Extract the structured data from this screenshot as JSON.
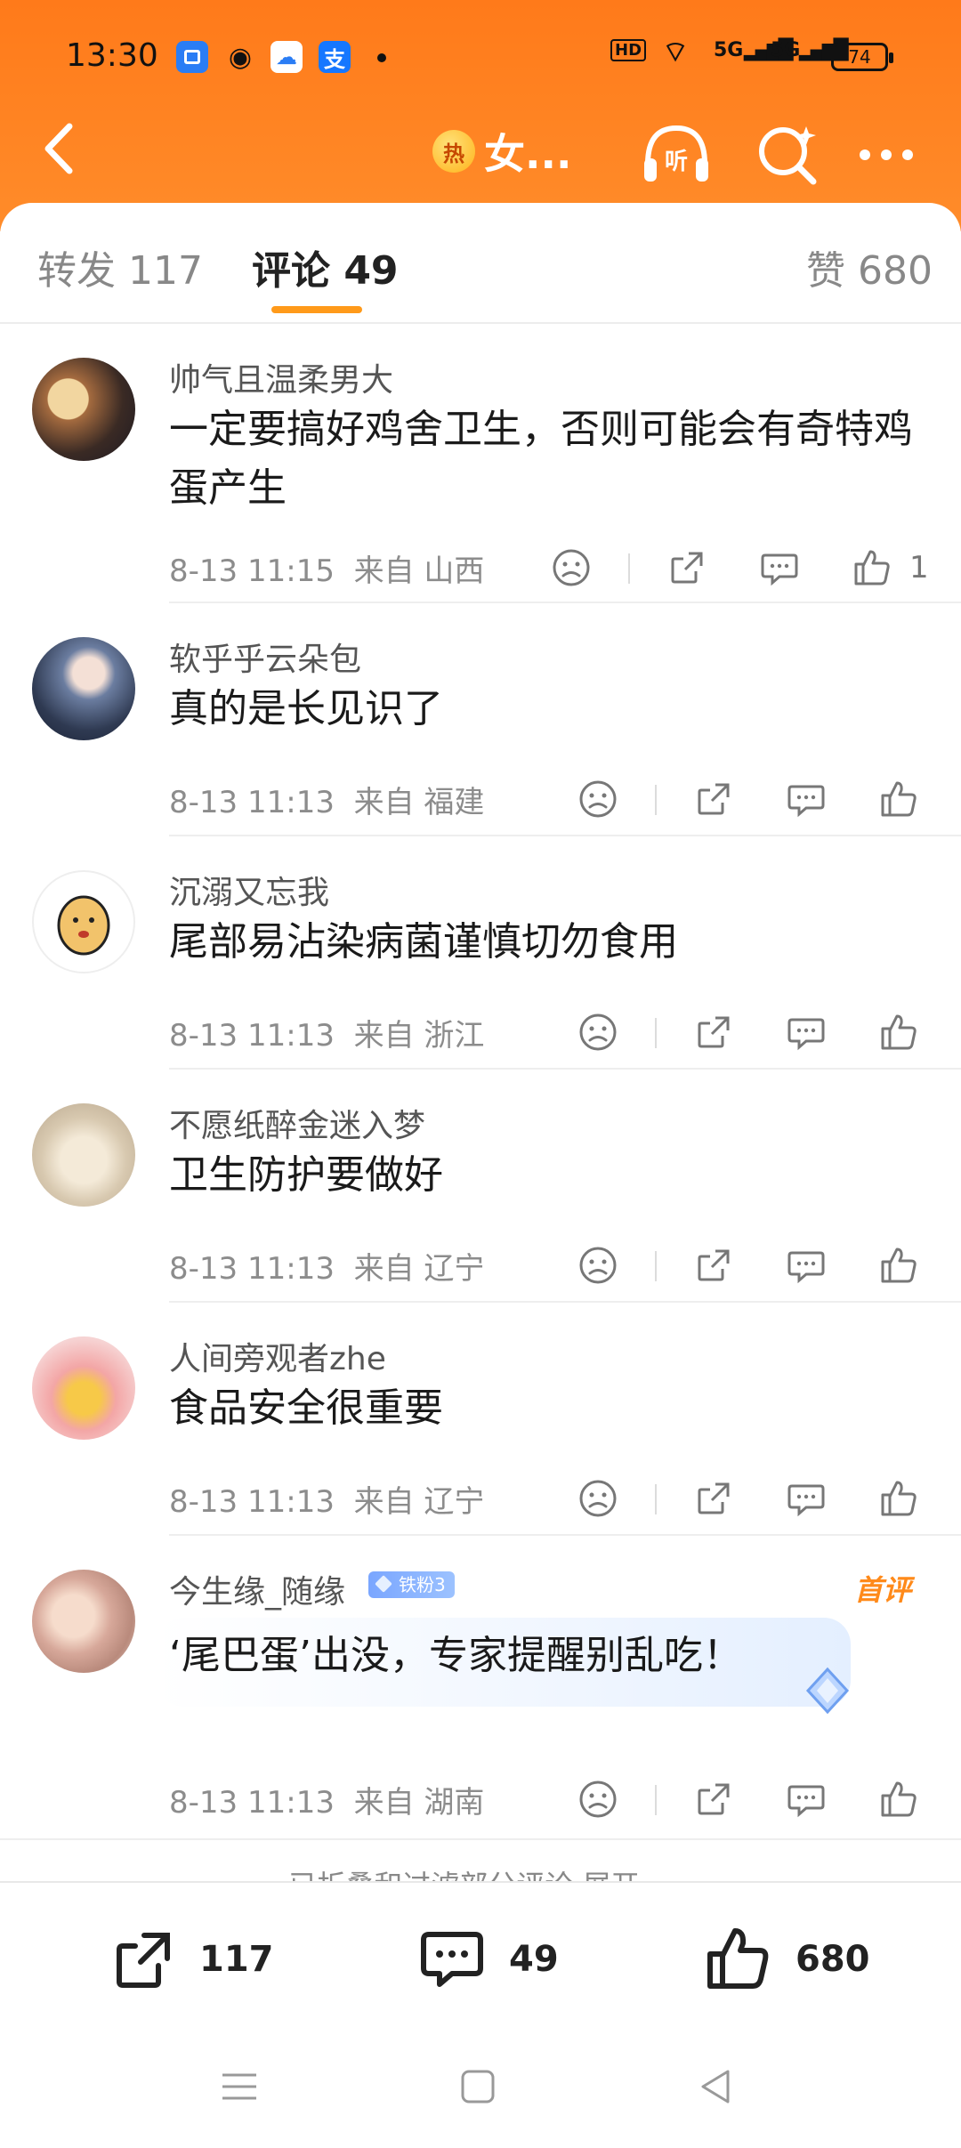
{
  "status_bar": {
    "time": "13:30",
    "hd": "HD",
    "net1": "5G",
    "net2": "5G",
    "battery": "74"
  },
  "nav": {
    "title": "女..."
  },
  "tabs": {
    "repost": "转发 117",
    "comment": "评论 49",
    "like": "赞 680"
  },
  "comments": [
    {
      "username": "帅气且温柔男大",
      "text": "一定要搞好鸡舍卫生，否则可能会有奇特鸡蛋产生",
      "time": "8-13 11:15",
      "location": "来自 山西",
      "likes": "1"
    },
    {
      "username": "软乎乎云朵包",
      "text": "真的是长见识了",
      "time": "8-13 11:13",
      "location": "来自 福建",
      "likes": ""
    },
    {
      "username": "沉溺又忘我",
      "text": "尾部易沾染病菌谨慎切勿食用",
      "time": "8-13 11:13",
      "location": "来自 浙江",
      "likes": ""
    },
    {
      "username": "不愿纸醉金迷入梦",
      "text": "卫生防护要做好",
      "time": "8-13 11:13",
      "location": "来自 辽宁",
      "likes": ""
    },
    {
      "username": "人间旁观者zhe",
      "text": "食品安全很重要",
      "time": "8-13 11:13",
      "location": "来自 辽宁",
      "likes": ""
    },
    {
      "username": "今生缘_随缘",
      "badge": "铁粉3",
      "first_label": "首评",
      "text": "‘尾巴蛋’出没，专家提醒别乱吃！",
      "time": "8-13 11:13",
      "location": "来自 湖南",
      "likes": ""
    }
  ],
  "collapse_note": "已折叠和过滤部分评论 展开 ⌄",
  "bottom_bar": {
    "repost_count": "117",
    "comment_count": "49",
    "like_count": "680"
  },
  "colors": {
    "header": "#ff7a1a",
    "accent": "#ff9a1a",
    "fans_badge": "#7aa6ff"
  },
  "icons": [
    "back-arrow-icon",
    "hot-icon",
    "listen-icon",
    "search-icon",
    "more-icon",
    "dislike-icon",
    "share-icon",
    "comment-icon",
    "like-icon",
    "menu-icon",
    "home-icon",
    "back-icon"
  ]
}
